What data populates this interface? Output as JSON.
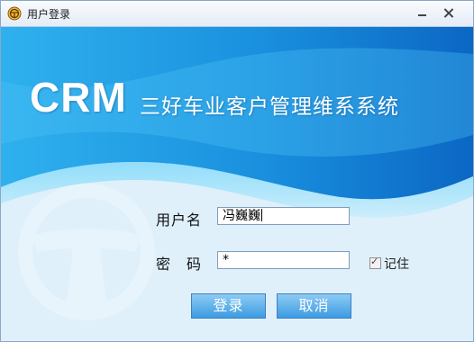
{
  "window": {
    "title": "用户登录"
  },
  "banner": {
    "brand": "CRM",
    "subtitle": "三好车业客户管理维系系统"
  },
  "form": {
    "username_label": "用户名",
    "username_value": "冯巍巍",
    "password_label": "密码",
    "password_value": "*",
    "remember_label": "记住",
    "remember_checked": true
  },
  "buttons": {
    "login": "登录",
    "cancel": "取消"
  },
  "colors": {
    "banner_top": "#0a6cc9",
    "banner_light": "#58c1f5",
    "panel_bg": "#dff0fb",
    "button_top": "#8dcbf3",
    "button_bottom": "#3c9be2"
  },
  "icons": {
    "app": "steering-wheel-icon",
    "minimize": "minimize-icon",
    "close": "close-icon",
    "watermark": "steering-wheel-watermark"
  }
}
